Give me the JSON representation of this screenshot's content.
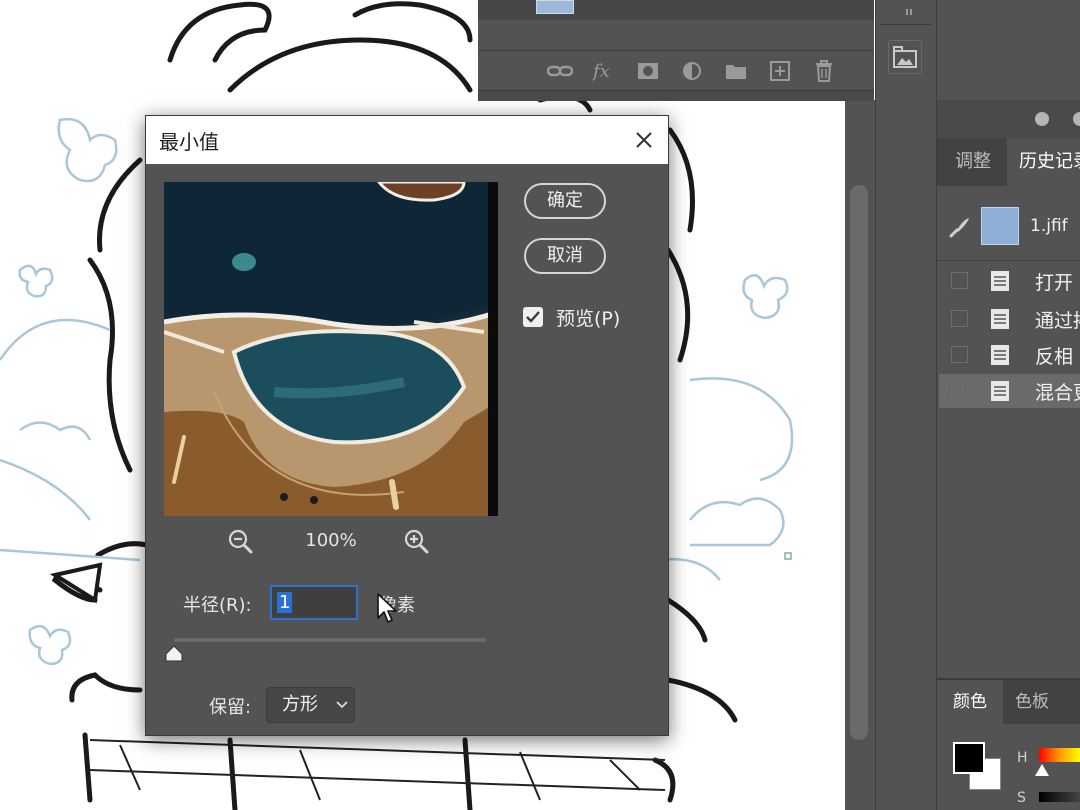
{
  "dialog": {
    "title": "最小值",
    "ok_label": "确定",
    "cancel_label": "取消",
    "preview_label": "预览(P)",
    "preview_checked": true,
    "zoom_level": "100%",
    "radius_label": "半径(R):",
    "radius_value": "1",
    "radius_unit": "像素",
    "radius_slider_fraction": 0.0,
    "preserve_label": "保留:",
    "preserve_value": "方形"
  },
  "right_panel": {
    "tabs": [
      "调整",
      "历史记录"
    ],
    "active_tab": "历史记录",
    "snapshot_label": "1.jfif",
    "history_items": [
      "打开",
      "通过拷贝的图层",
      "反相",
      "混合更改"
    ],
    "lower_tabs": [
      "颜色",
      "色板"
    ],
    "active_lower_tab": "颜色",
    "color_labels": {
      "h": "H",
      "s": "S"
    },
    "foreground_color": "#000000",
    "background_color": "#ffffff"
  },
  "icons": {
    "layers_toolbar": [
      "link-layers-icon",
      "fx-icon",
      "layer-mask-icon",
      "adjustment-layer-icon",
      "group-folder-icon",
      "new-layer-icon",
      "trash-icon"
    ]
  }
}
